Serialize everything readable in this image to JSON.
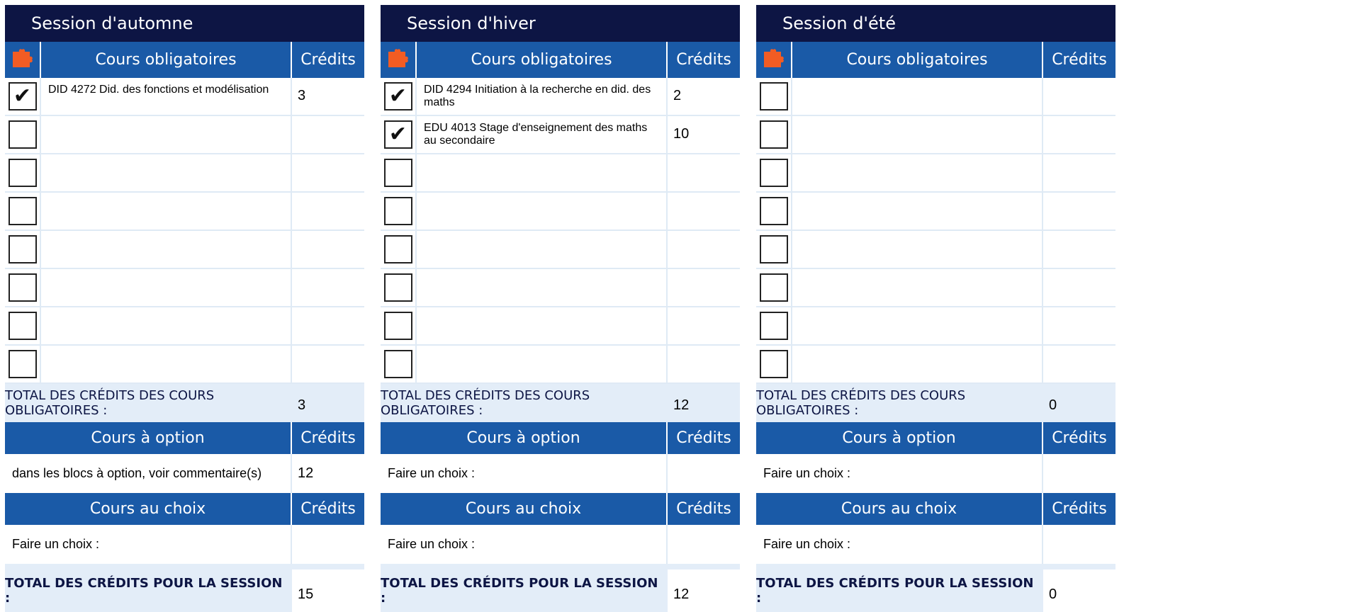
{
  "accent": "#f25c23",
  "sessions": [
    {
      "title": "Session  d'automne",
      "required_header": "Cours obligatoires",
      "credits_header": "Crédits",
      "courses": [
        {
          "checked": true,
          "name": "DID 4272 Did. des fonctions et modélisation",
          "credits": "3"
        },
        {
          "checked": false,
          "name": "",
          "credits": ""
        },
        {
          "checked": false,
          "name": "",
          "credits": ""
        },
        {
          "checked": false,
          "name": "",
          "credits": ""
        },
        {
          "checked": false,
          "name": "",
          "credits": ""
        },
        {
          "checked": false,
          "name": "",
          "credits": ""
        },
        {
          "checked": false,
          "name": "",
          "credits": ""
        },
        {
          "checked": false,
          "name": "",
          "credits": ""
        }
      ],
      "required_total_label": "TOTAL DES CRÉDITS DES COURS OBLIGATOIRES :",
      "required_total": "3",
      "option_header": "Cours à option",
      "option_text": "dans les blocs à option, voir commentaire(s)",
      "option_credits": "12",
      "choice_header": "Cours au choix",
      "choice_text": "Faire un choix :",
      "choice_credits": "",
      "session_total_label": "TOTAL DES CRÉDITS POUR LA SESSION :",
      "session_total": "15"
    },
    {
      "title": "Session d'hiver",
      "required_header": "Cours obligatoires",
      "credits_header": "Crédits",
      "courses": [
        {
          "checked": true,
          "name": "DID 4294 Initiation à la recherche en did. des maths",
          "credits": "2"
        },
        {
          "checked": true,
          "name": "EDU 4013 Stage d'enseignement des maths au secondaire",
          "credits": "10"
        },
        {
          "checked": false,
          "name": "",
          "credits": ""
        },
        {
          "checked": false,
          "name": "",
          "credits": ""
        },
        {
          "checked": false,
          "name": "",
          "credits": ""
        },
        {
          "checked": false,
          "name": "",
          "credits": ""
        },
        {
          "checked": false,
          "name": "",
          "credits": ""
        },
        {
          "checked": false,
          "name": "",
          "credits": ""
        }
      ],
      "required_total_label": "TOTAL DES CRÉDITS DES COURS OBLIGATOIRES :",
      "required_total": "12",
      "option_header": "Cours à option",
      "option_text": "Faire un choix :",
      "option_credits": "",
      "choice_header": "Cours au choix",
      "choice_text": "Faire un choix :",
      "choice_credits": "",
      "session_total_label": "TOTAL DES CRÉDITS POUR LA SESSION :",
      "session_total": "12"
    },
    {
      "title": "Session d'été",
      "required_header": "Cours obligatoires",
      "credits_header": "Crédits",
      "courses": [
        {
          "checked": false,
          "name": "",
          "credits": ""
        },
        {
          "checked": false,
          "name": "",
          "credits": ""
        },
        {
          "checked": false,
          "name": "",
          "credits": ""
        },
        {
          "checked": false,
          "name": "",
          "credits": ""
        },
        {
          "checked": false,
          "name": "",
          "credits": ""
        },
        {
          "checked": false,
          "name": "",
          "credits": ""
        },
        {
          "checked": false,
          "name": "",
          "credits": ""
        },
        {
          "checked": false,
          "name": "",
          "credits": ""
        }
      ],
      "required_total_label": "TOTAL DES CRÉDITS DES COURS OBLIGATOIRES :",
      "required_total": "0",
      "option_header": "Cours à option",
      "option_text": "Faire un choix :",
      "option_credits": "",
      "choice_header": "Cours au choix",
      "choice_text": "Faire un choix :",
      "choice_credits": "",
      "session_total_label": "TOTAL DES CRÉDITS POUR LA SESSION :",
      "session_total": "0"
    }
  ]
}
